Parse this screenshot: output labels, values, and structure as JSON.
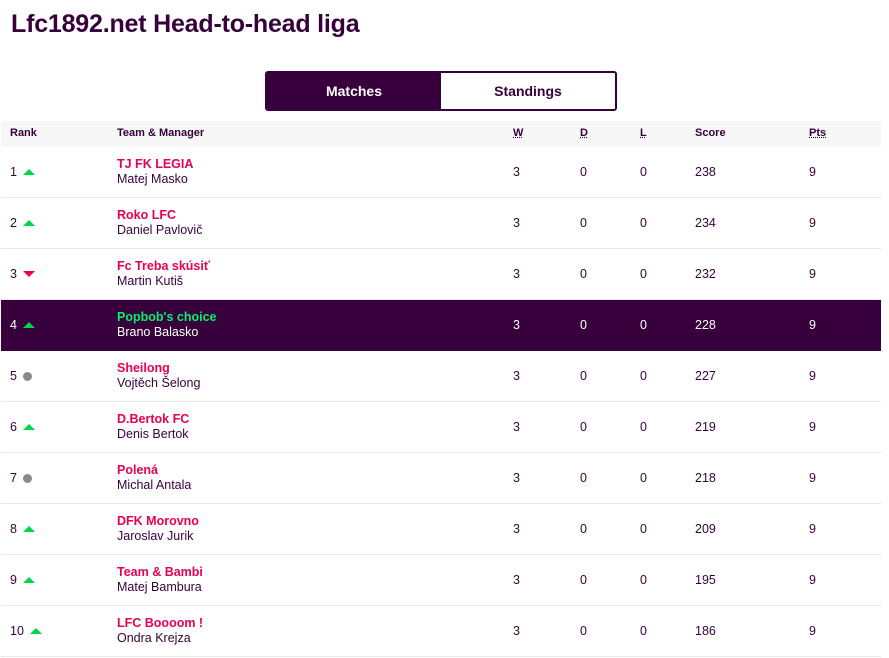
{
  "page": {
    "title": "Lfc1892.net Head-to-head liga"
  },
  "tabs": [
    {
      "label": "Matches",
      "active": true
    },
    {
      "label": "Standings",
      "active": false
    }
  ],
  "table": {
    "headers": {
      "rank": "Rank",
      "team_manager": "Team & Manager",
      "w": "W",
      "d": "D",
      "l": "L",
      "score": "Score",
      "pts": "Pts"
    },
    "rows": [
      {
        "rank": "1",
        "movement": "up",
        "team": "TJ FK LEGIA",
        "manager": "Matej Masko",
        "w": "3",
        "d": "0",
        "l": "0",
        "score": "238",
        "pts": "9",
        "highlight": false
      },
      {
        "rank": "2",
        "movement": "up",
        "team": "Roko LFC",
        "manager": "Daniel Pavlovič",
        "w": "3",
        "d": "0",
        "l": "0",
        "score": "234",
        "pts": "9",
        "highlight": false
      },
      {
        "rank": "3",
        "movement": "down",
        "team": "Fc Treba skúsiť",
        "manager": "Martin Kutiš",
        "w": "3",
        "d": "0",
        "l": "0",
        "score": "232",
        "pts": "9",
        "highlight": false
      },
      {
        "rank": "4",
        "movement": "up",
        "team": "Popbob's choice",
        "manager": "Brano Balasko",
        "w": "3",
        "d": "0",
        "l": "0",
        "score": "228",
        "pts": "9",
        "highlight": true
      },
      {
        "rank": "5",
        "movement": "same",
        "team": "Sheilong",
        "manager": "Vojtěch Šelong",
        "w": "3",
        "d": "0",
        "l": "0",
        "score": "227",
        "pts": "9",
        "highlight": false
      },
      {
        "rank": "6",
        "movement": "up",
        "team": "D.Bertok FC",
        "manager": "Denis Bertok",
        "w": "3",
        "d": "0",
        "l": "0",
        "score": "219",
        "pts": "9",
        "highlight": false
      },
      {
        "rank": "7",
        "movement": "same",
        "team": "Polená",
        "manager": "Michal Antala",
        "w": "3",
        "d": "0",
        "l": "0",
        "score": "218",
        "pts": "9",
        "highlight": false
      },
      {
        "rank": "8",
        "movement": "up",
        "team": "DFK Morovno",
        "manager": "Jaroslav Jurik",
        "w": "3",
        "d": "0",
        "l": "0",
        "score": "209",
        "pts": "9",
        "highlight": false
      },
      {
        "rank": "9",
        "movement": "up",
        "team": "Team & Bambi",
        "manager": "Matej Bambura",
        "w": "3",
        "d": "0",
        "l": "0",
        "score": "195",
        "pts": "9",
        "highlight": false
      },
      {
        "rank": "10",
        "movement": "up",
        "team": "LFC Boooom !",
        "manager": "Ondra Krejza",
        "w": "3",
        "d": "0",
        "l": "0",
        "score": "186",
        "pts": "9",
        "highlight": false
      }
    ]
  },
  "colors": {
    "brand_purple": "#37003c",
    "team_link": "#e90052",
    "highlight_team": "#05f06b",
    "movement_up": "#00d44a",
    "movement_down": "#e90052",
    "movement_same": "#8a8a8a"
  }
}
